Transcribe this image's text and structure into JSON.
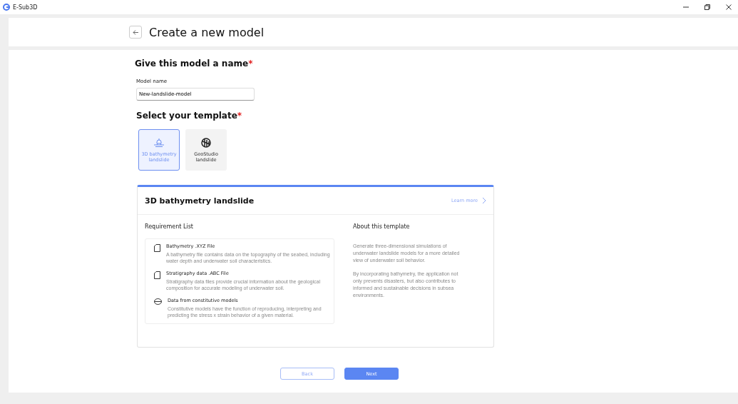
{
  "window": {
    "title": "E-Sub3D"
  },
  "header": {
    "title": "Create a new model"
  },
  "name_section": {
    "heading": "Give this model a name",
    "required_mark": "*",
    "field_label": "Model name",
    "value": "New-landslide-model"
  },
  "template_section": {
    "heading": "Select your template",
    "required_mark": "*"
  },
  "templates": [
    {
      "label": "3D bathymetry landslide",
      "kind": "bathymetry",
      "selected": true
    },
    {
      "label": "GeoStudio landslide",
      "kind": "geostudio",
      "selected": false
    }
  ],
  "details": {
    "title": "3D bathymetry landslide",
    "link": "Learn more",
    "requirements_heading": "Requirement List",
    "about_heading": "About this template",
    "requirements": [
      {
        "kind": "file",
        "title": "Bathymetry .XYZ File",
        "description": "A bathymetry file contains data on the topography of the seabed, including water depth and underwater soil characteristics."
      },
      {
        "kind": "file",
        "title": "Stratigraphy data .ABC File",
        "description": "Stratigraphy data files provide crucial information about the geological composition for accurate modeling of underwater soil."
      },
      {
        "kind": "database",
        "title": "Data from constitutive models",
        "description": "Constitutive models have the function of reproducing, interpreting and predicting the stress x strain behavior of a given material."
      }
    ],
    "about": [
      "Generate three-dimensional simulations of underwater landslide models for a more detailed view of underwater soil behavior.",
      "By incorporating bathymetry, the application not only prevents disasters, but also contributes to informed and sustainable decisions in subsea environments."
    ]
  },
  "buttons": [
    {
      "label": "Back",
      "kind": "secondary"
    },
    {
      "label": "Next",
      "kind": "primary"
    }
  ]
}
